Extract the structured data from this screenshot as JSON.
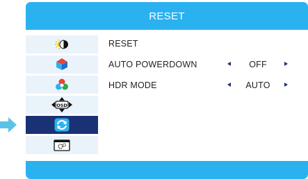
{
  "header": {
    "title": "RESET"
  },
  "sidebar": {
    "items": [
      {
        "icon": "brightness-contrast-icon"
      },
      {
        "icon": "color-icon"
      },
      {
        "icon": "rgb-color-icon"
      },
      {
        "icon": "osd-settings-icon"
      },
      {
        "icon": "reset-icon",
        "selected": true
      },
      {
        "icon": "system-setup-icon"
      }
    ]
  },
  "pointer": {
    "icon": "pointer-arrow-icon"
  },
  "menu": {
    "reset": {
      "label": "RESET"
    },
    "auto_powerdown": {
      "label": "AUTO POWERDOWN",
      "value": "OFF"
    },
    "hdr_mode": {
      "label": "HDR MODE",
      "value": "AUTO"
    }
  },
  "colors": {
    "accent": "#2ab1ef",
    "selected": "#1a3175",
    "item_bg": "#eaf3fa"
  }
}
